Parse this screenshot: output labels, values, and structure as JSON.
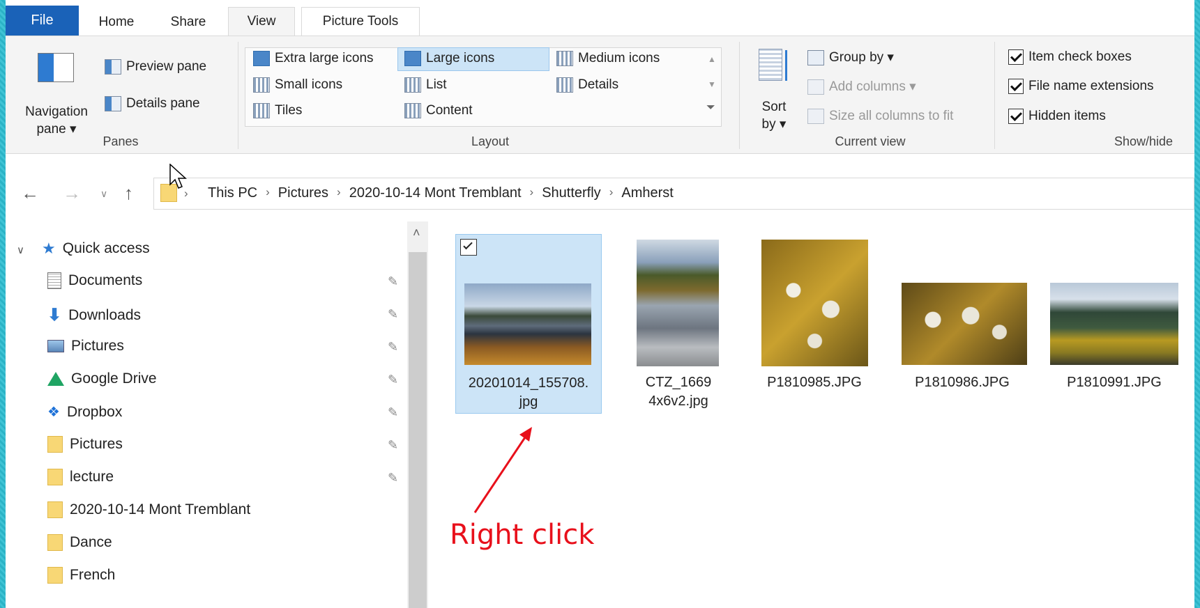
{
  "tabs": {
    "file": "File",
    "home": "Home",
    "share": "Share",
    "view": "View",
    "picture_tools": "Picture Tools"
  },
  "ribbon": {
    "panes": {
      "navigation_pane": "Navigation",
      "navigation_pane2": "pane ▾",
      "preview_pane": "Preview pane",
      "details_pane": "Details pane",
      "label": "Panes"
    },
    "layout": {
      "extra_large": "Extra large icons",
      "large": "Large icons",
      "medium": "Medium icons",
      "small": "Small icons",
      "list": "List",
      "details": "Details",
      "tiles": "Tiles",
      "content": "Content",
      "label": "Layout"
    },
    "current_view": {
      "sort": "Sort",
      "sort_by": "by ▾",
      "group_by": "Group by ▾",
      "add_columns": "Add columns ▾",
      "size_columns": "Size all columns to fit",
      "label": "Current view"
    },
    "show_hide": {
      "item_check_boxes": "Item check boxes",
      "file_name_extensions": "File name extensions",
      "hidden_items": "Hidden items",
      "label": "Show/hide"
    }
  },
  "breadcrumb": [
    "This PC",
    "Pictures",
    "2020-10-14 Mont Tremblant",
    "Shutterfly",
    "Amherst"
  ],
  "nav": {
    "quick_access": "Quick access",
    "items": [
      "Documents",
      "Downloads",
      "Pictures",
      "Google Drive",
      "Dropbox",
      "Pictures",
      "lecture",
      "2020-10-14 Mont Tremblant",
      "Dance",
      "French"
    ]
  },
  "files": [
    {
      "name1": "20201014_155708.",
      "name2": "jpg"
    },
    {
      "name1": "CTZ_1669",
      "name2": "4x6v2.jpg"
    },
    {
      "name1": "P1810985.JPG",
      "name2": ""
    },
    {
      "name1": "P1810986.JPG",
      "name2": ""
    },
    {
      "name1": "P1810991.JPG",
      "name2": ""
    }
  ],
  "annotation": "Right click",
  "colors": {
    "file_tab": "#1a62b8",
    "selection": "#cce4f7",
    "annotation": "#e8101b"
  }
}
